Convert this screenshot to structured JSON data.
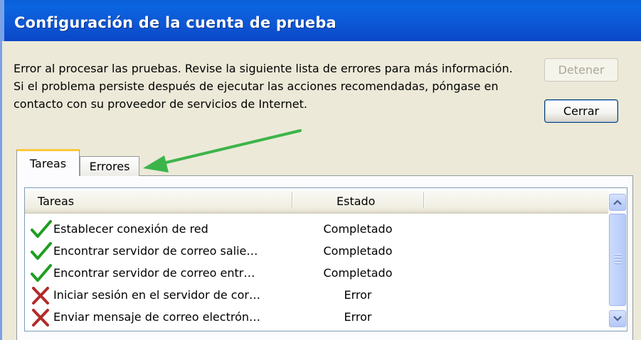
{
  "window": {
    "title": "Configuración de la cuenta de prueba"
  },
  "message": "Error al procesar las pruebas. Revise la siguiente lista de errores para más información. Si el problema persiste después de ejecutar las acciones recomendadas, póngase en contacto con su proveedor de servicios de Internet.",
  "buttons": {
    "stop_label": "Detener",
    "close_label": "Cerrar"
  },
  "tabs": [
    {
      "label": "Tareas",
      "selected": true
    },
    {
      "label": "Errores",
      "selected": false
    }
  ],
  "list": {
    "columns": [
      "Tareas",
      "Estado"
    ],
    "rows": [
      {
        "icon": "check-icon",
        "task": "Establecer conexión de red",
        "status": "Completado"
      },
      {
        "icon": "check-icon",
        "task": "Encontrar servidor de correo salie…",
        "status": "Completado"
      },
      {
        "icon": "check-icon",
        "task": "Encontrar servidor de correo entr…",
        "status": "Completado"
      },
      {
        "icon": "error-x-icon",
        "task": "Iniciar sesión en el servidor de cor…",
        "status": "Error"
      },
      {
        "icon": "error-x-icon",
        "task": "Enviar mensaje de correo electrón…",
        "status": "Error"
      }
    ]
  },
  "colors": {
    "titlebar": "#0b5cd7",
    "check": "#1e9e1e",
    "error_x": "#b22a2a",
    "annotation_arrow": "#3cb44a",
    "tab_highlight": "#ffc83c"
  }
}
